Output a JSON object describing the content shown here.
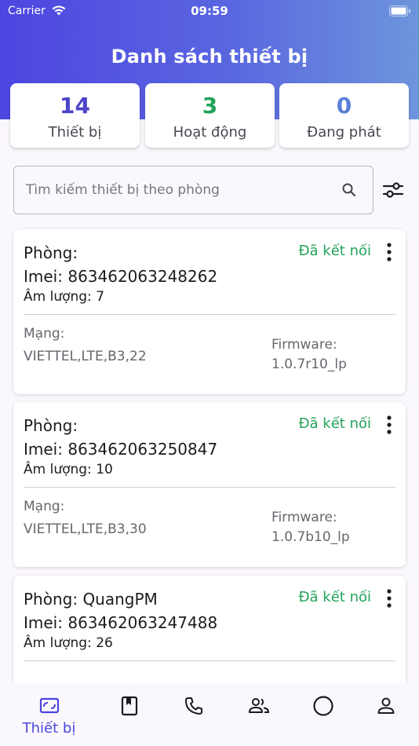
{
  "status_bar": {
    "carrier": "Carrier",
    "time": "09:59"
  },
  "header": {
    "title": "Danh sách thiết bị"
  },
  "stats": [
    {
      "value": "14",
      "label": "Thiết bị",
      "color": "#4b44c9"
    },
    {
      "value": "3",
      "label": "Hoạt động",
      "color": "#23a35a"
    },
    {
      "value": "0",
      "label": "Đang phát",
      "color": "#5a7fd6"
    }
  ],
  "search": {
    "placeholder": "Tìm kiếm thiết bị theo phòng"
  },
  "devices": [
    {
      "room": "Phòng:",
      "imei": "Imei: 863462063248262",
      "volume": "Âm lượng: 7",
      "status": "Đã kết nối",
      "network_label": "Mạng:",
      "network_value": "VIETTEL,LTE,B3,22",
      "firmware_label": "Firmware:",
      "firmware_value": "1.0.7r10_lp"
    },
    {
      "room": "Phòng:",
      "imei": "Imei: 863462063250847",
      "volume": "Âm lượng: 10",
      "status": "Đã kết nối",
      "network_label": "Mạng:",
      "network_value": "VIETTEL,LTE,B3,30",
      "firmware_label": "Firmware:",
      "firmware_value": "1.0.7b10_lp"
    },
    {
      "room": "Phòng: QuangPM",
      "imei": "Imei: 863462063247488",
      "volume": "Âm lượng: 26",
      "status": "Đã kết nối",
      "network_label": "",
      "network_value": "",
      "firmware_label": "",
      "firmware_value": ""
    }
  ],
  "bottom_nav": {
    "active_label": "Thiết bị",
    "items": [
      "device-icon",
      "book-icon",
      "phone-icon",
      "people-icon",
      "circle-icon",
      "person-icon"
    ]
  },
  "colors": {
    "accent": "#4d45e0",
    "connected": "#24a35a"
  }
}
